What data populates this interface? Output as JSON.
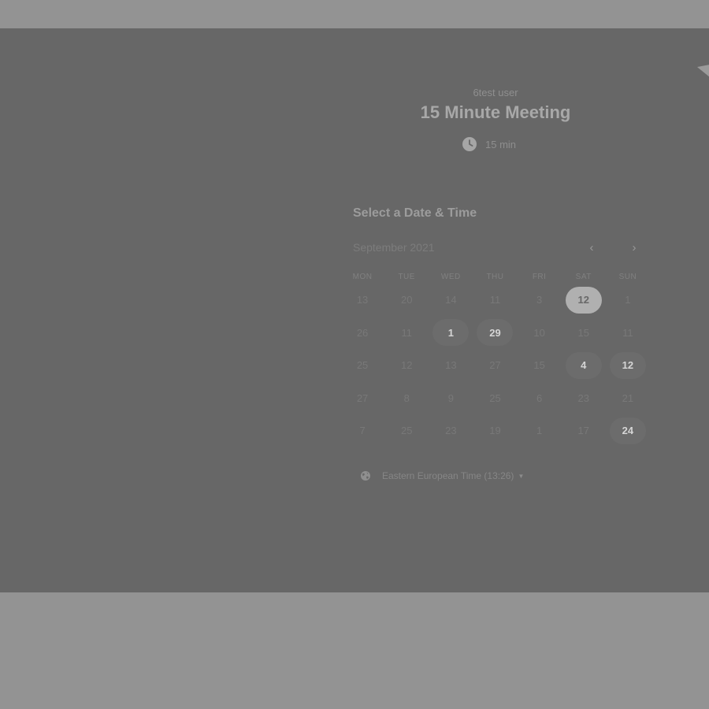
{
  "event": {
    "host": "6test user",
    "title": "15 Minute Meeting",
    "duration": "15 min"
  },
  "calendar": {
    "section_title": "Select a Date & Time",
    "month_label": "September 2021",
    "prev_label": "‹",
    "next_label": "›",
    "weekdays": [
      "MON",
      "TUE",
      "WED",
      "THU",
      "FRI",
      "SAT",
      "SUN"
    ],
    "weeks": [
      [
        {
          "label": "13",
          "state": "unavailable"
        },
        {
          "label": "20",
          "state": "unavailable"
        },
        {
          "label": "14",
          "state": "unavailable"
        },
        {
          "label": "11",
          "state": "unavailable"
        },
        {
          "label": "3",
          "state": "unavailable"
        },
        {
          "label": "12",
          "state": "selected"
        },
        {
          "label": "1",
          "state": "unavailable"
        }
      ],
      [
        {
          "label": "26",
          "state": "unavailable"
        },
        {
          "label": "11",
          "state": "unavailable"
        },
        {
          "label": "1",
          "state": "available"
        },
        {
          "label": "29",
          "state": "available"
        },
        {
          "label": "10",
          "state": "unavailable"
        },
        {
          "label": "15",
          "state": "unavailable"
        },
        {
          "label": "11",
          "state": "unavailable"
        }
      ],
      [
        {
          "label": "25",
          "state": "unavailable"
        },
        {
          "label": "12",
          "state": "unavailable"
        },
        {
          "label": "13",
          "state": "unavailable"
        },
        {
          "label": "27",
          "state": "unavailable"
        },
        {
          "label": "15",
          "state": "unavailable"
        },
        {
          "label": "4",
          "state": "available"
        },
        {
          "label": "12",
          "state": "available"
        }
      ],
      [
        {
          "label": "27",
          "state": "unavailable"
        },
        {
          "label": "8",
          "state": "unavailable"
        },
        {
          "label": "9",
          "state": "unavailable"
        },
        {
          "label": "25",
          "state": "unavailable"
        },
        {
          "label": "6",
          "state": "unavailable"
        },
        {
          "label": "23",
          "state": "unavailable"
        },
        {
          "label": "21",
          "state": "unavailable"
        }
      ],
      [
        {
          "label": "7",
          "state": "unavailable"
        },
        {
          "label": "25",
          "state": "unavailable"
        },
        {
          "label": "23",
          "state": "unavailable"
        },
        {
          "label": "19",
          "state": "unavailable"
        },
        {
          "label": "1",
          "state": "unavailable"
        },
        {
          "label": "17",
          "state": "unavailable"
        },
        {
          "label": "24",
          "state": "available"
        }
      ]
    ]
  },
  "timezone": {
    "label": "Eastern European Time (13:26)"
  },
  "icons": {
    "duration": "clock-icon",
    "timezone": "globe-icon",
    "timezone_dropdown": "caret-down-icon",
    "prev_month": "chevron-left-icon",
    "next_month": "chevron-right-icon",
    "corner": "corner-ribbon-icon"
  },
  "colors": {
    "page_background": "#939393",
    "card_background": "#676767",
    "selected_day": "#b0b0b0",
    "available_day_text": "#d5d5d5"
  }
}
